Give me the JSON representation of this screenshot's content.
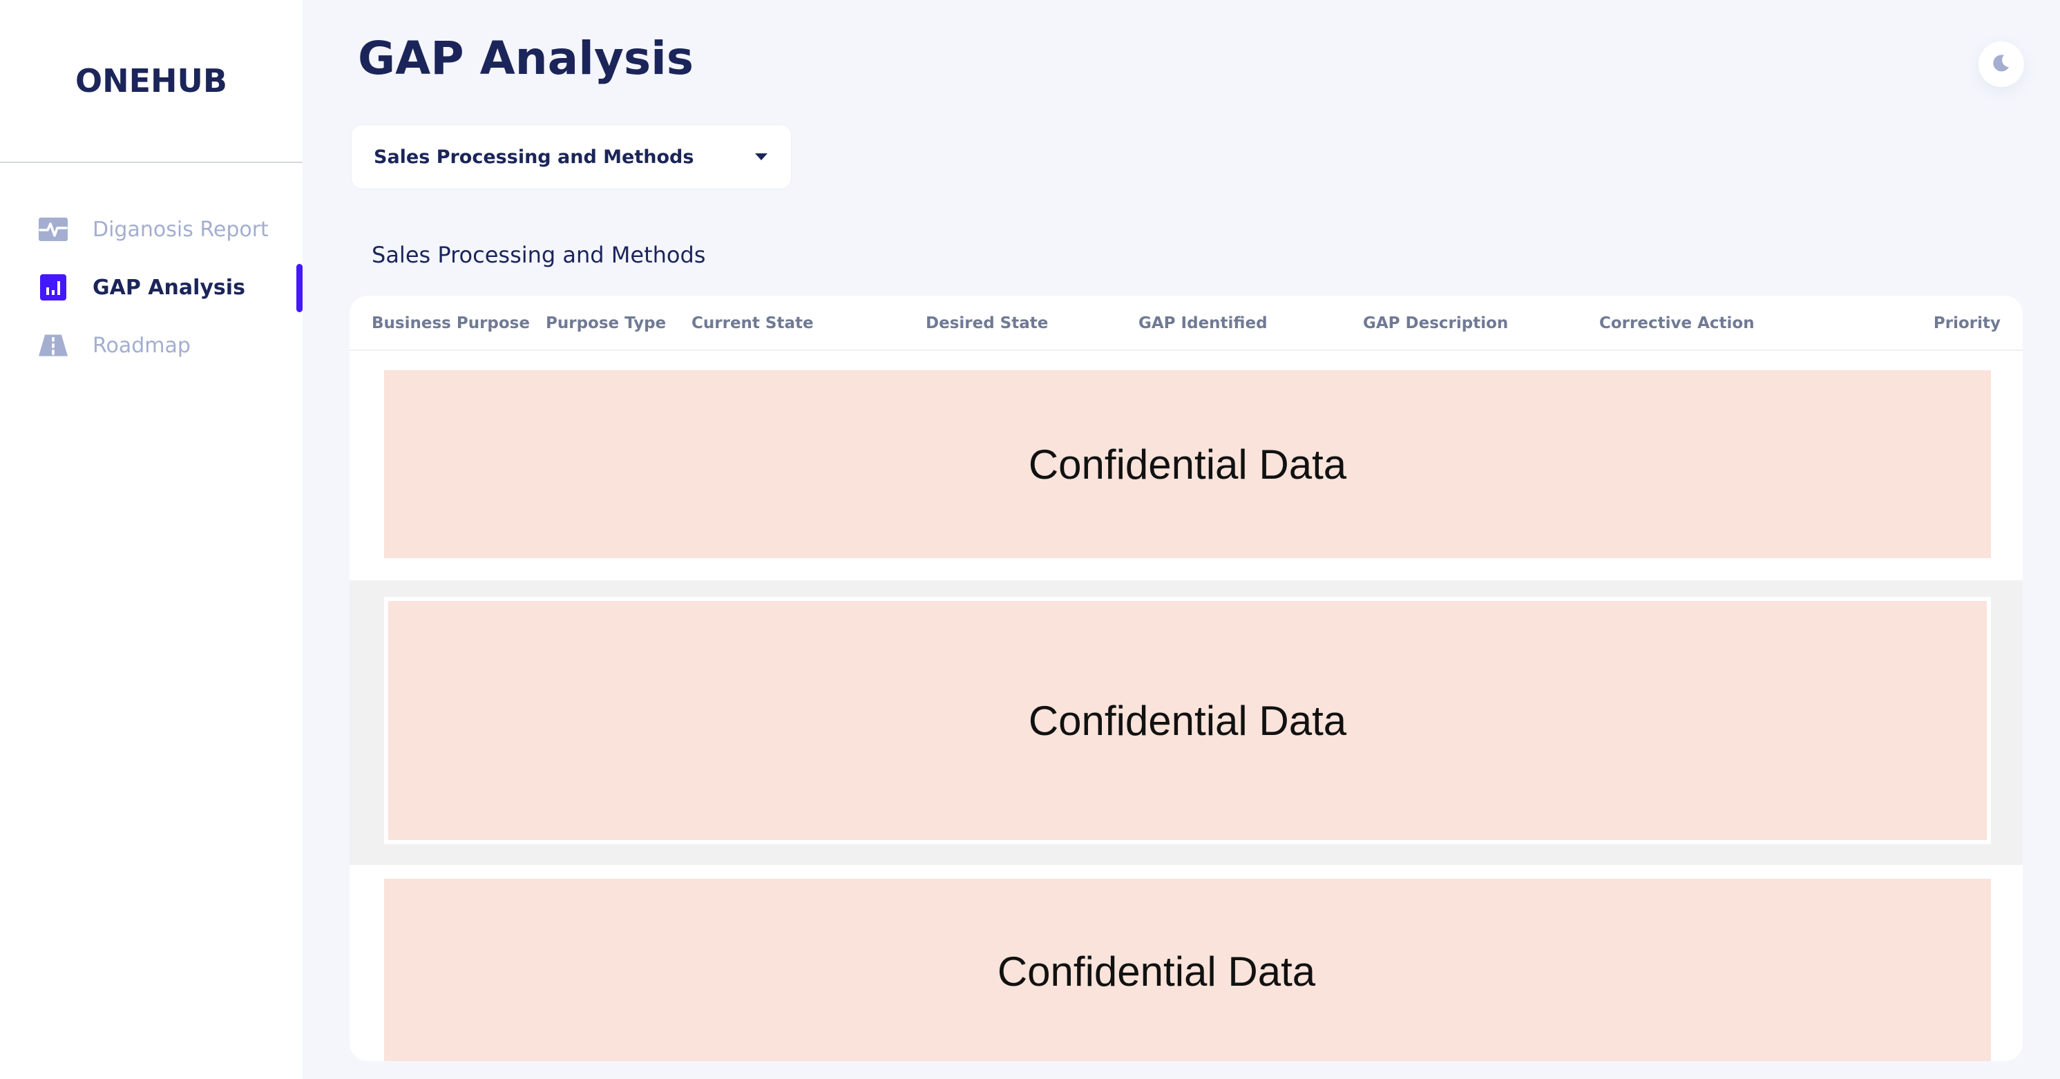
{
  "sidebar": {
    "brand": "ONEHUB",
    "items": [
      {
        "label": "Diganosis Report",
        "icon": "heartbeat-icon",
        "active": false
      },
      {
        "label": "GAP Analysis",
        "icon": "bar-chart-icon",
        "active": true
      },
      {
        "label": "Roadmap",
        "icon": "road-icon",
        "active": false
      }
    ]
  },
  "header": {
    "title": "GAP Analysis",
    "theme_toggle_icon": "moon-icon"
  },
  "filter": {
    "selected": "Sales Processing and Methods"
  },
  "section": {
    "title": "Sales Processing and Methods"
  },
  "table": {
    "columns": [
      "Business Purpose",
      "Purpose Type",
      "Current State",
      "Desired State",
      "GAP Identified",
      "GAP Description",
      "Corrective Action",
      "Priority"
    ],
    "rows": [
      {
        "text": "Confidential Data"
      },
      {
        "text": "Confidential Data"
      },
      {
        "text": "Confidential Data"
      }
    ]
  },
  "colors": {
    "accent": "#4318ff",
    "text_primary": "#1b2559",
    "text_muted": "#a3aed0",
    "redaction_fill": "#f9e3da"
  }
}
